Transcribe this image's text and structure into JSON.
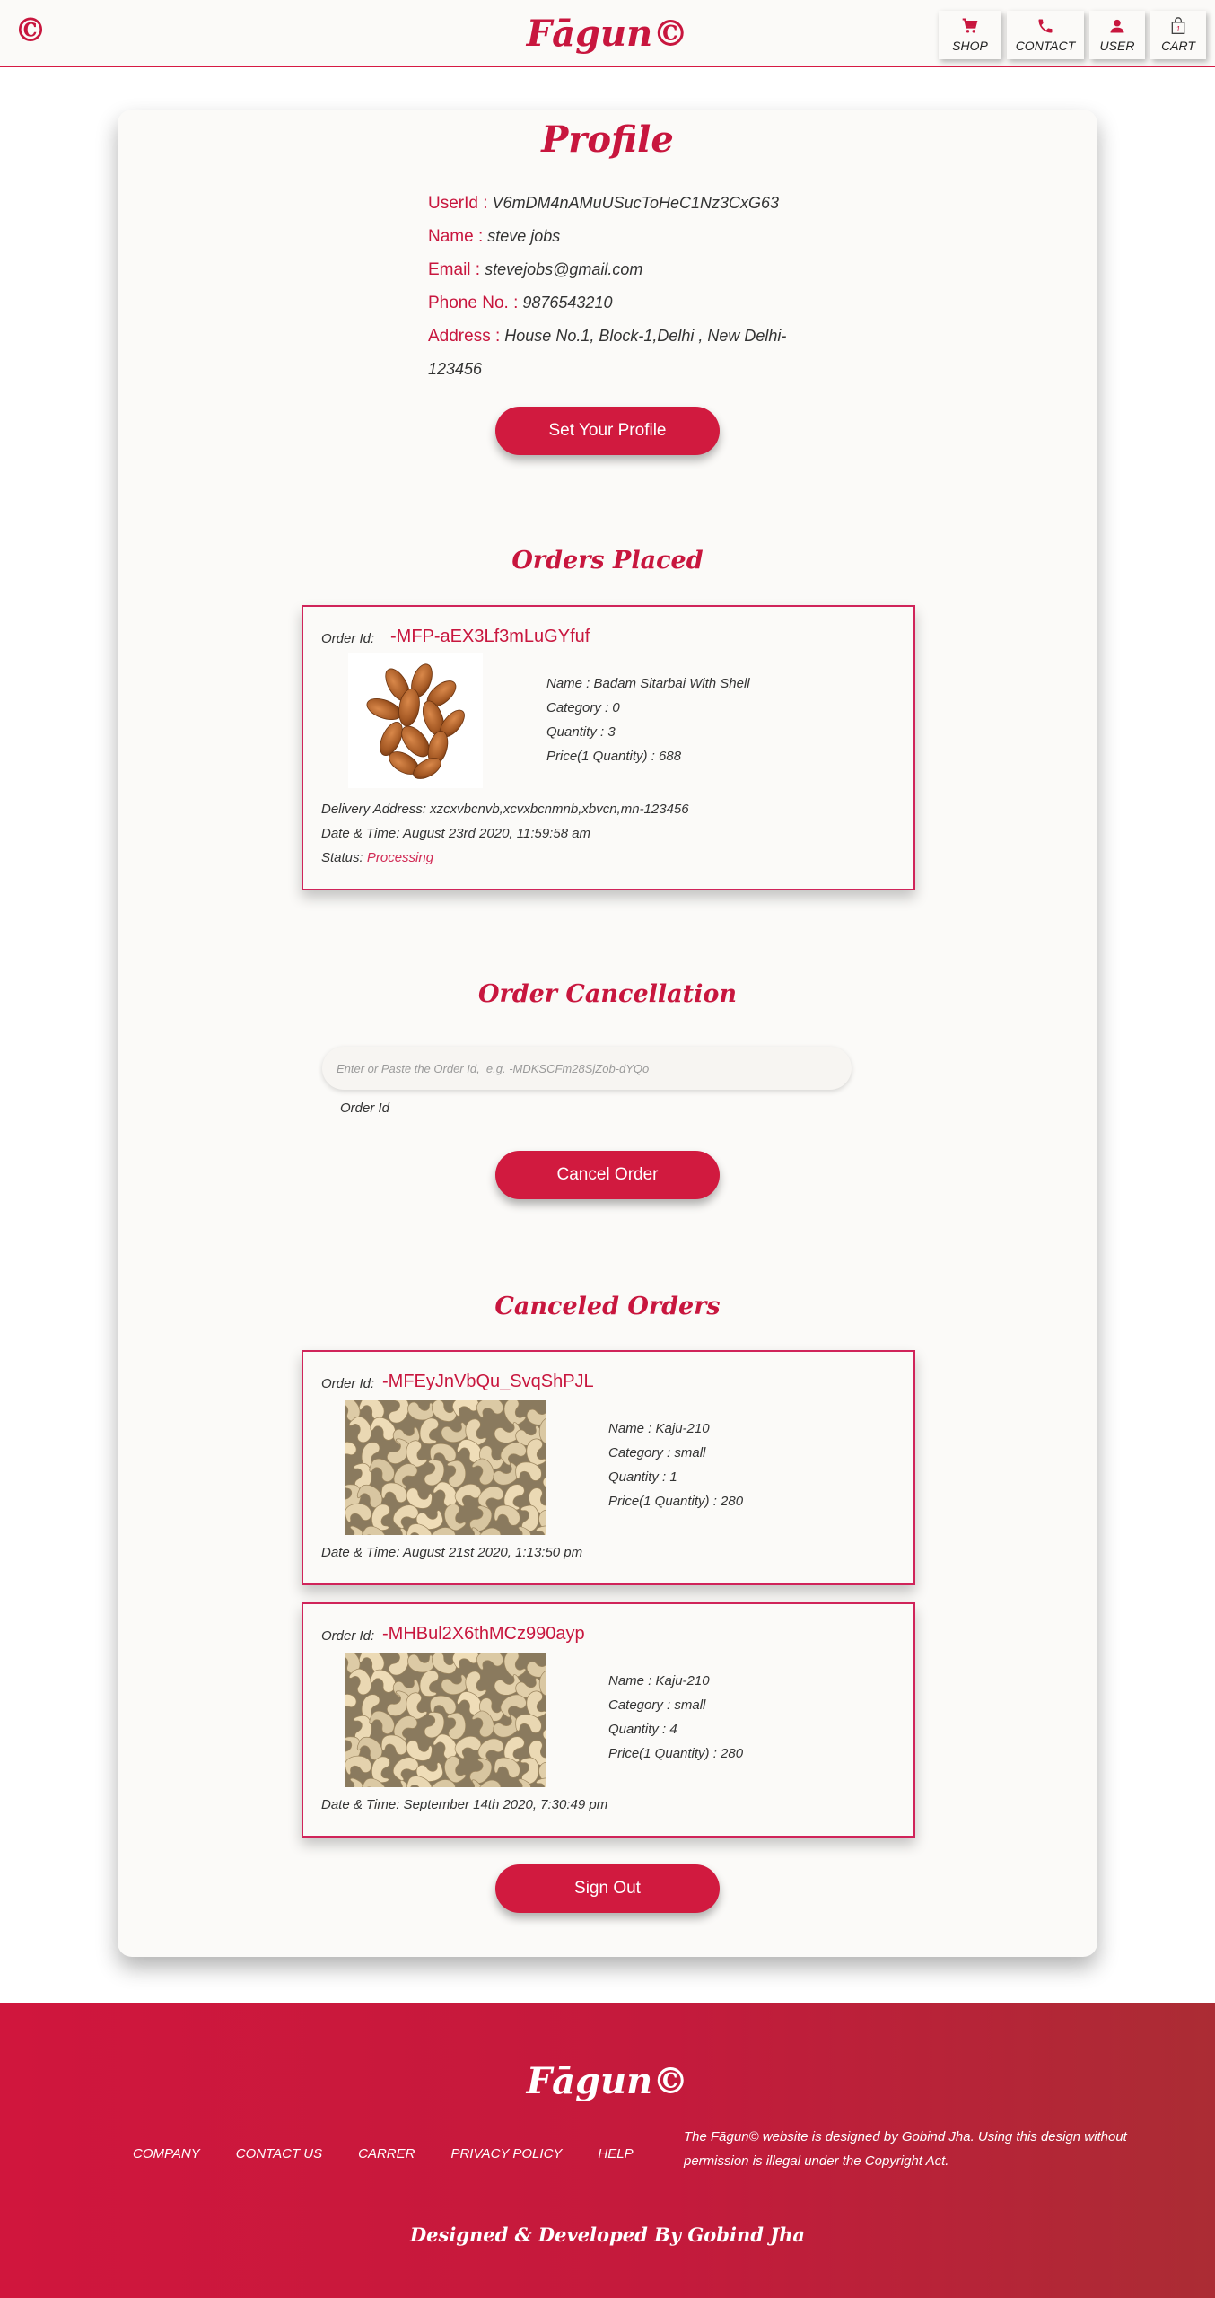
{
  "nav": {
    "logo": "©",
    "brand": "Fāgun©",
    "items": [
      {
        "label": "SHOP",
        "icon": "cart-icon"
      },
      {
        "label": "CONTACT",
        "icon": "phone-icon"
      },
      {
        "label": "USER",
        "icon": "user-icon"
      },
      {
        "label": "CART",
        "icon": "bag-icon",
        "count": "1"
      }
    ]
  },
  "profile": {
    "title": "Profile",
    "fields": [
      {
        "label": "UserId :",
        "value": "V6mDM4nAMuUSucToHeC1Nz3CxG63"
      },
      {
        "label": "Name :",
        "value": "steve jobs"
      },
      {
        "label": "Email :",
        "value": "stevejobs@gmail.com"
      },
      {
        "label": "Phone No. :",
        "value": "9876543210"
      },
      {
        "label": "Address :",
        "value": "House No.1, Block-1,Delhi , New Delhi-123456"
      }
    ],
    "set_profile_button": "Set Your Profile"
  },
  "orders_placed": {
    "title": "Orders Placed",
    "orders": [
      {
        "order_id_label": "Order Id:",
        "order_id": "-MFP-aEX3Lf3mLuGYfuf",
        "image": "almonds",
        "name": "Name : Badam Sitarbai With Shell",
        "category": "Category : 0",
        "quantity": "Quantity : 3",
        "price": "Price(1 Quantity) : 688",
        "delivery": "Delivery Address: xzcxvbcnvb,xcvxbcnmnb,xbvcn,mn-123456",
        "datetime": "Date & Time: August 23rd 2020, 11:59:58 am",
        "status_label": "Status:",
        "status": "Processing"
      }
    ]
  },
  "cancellation": {
    "title": "Order Cancellation",
    "input_placeholder": "Enter or Paste the Order Id,  e.g. -MDKSCFm28SjZob-dYQo",
    "input_label": "Order Id",
    "button": "Cancel Order"
  },
  "canceled_orders": {
    "title": "Canceled Orders",
    "orders": [
      {
        "order_id_label": "Order Id:",
        "order_id": "-MFEyJnVbQu_SvqShPJL",
        "image": "cashews",
        "name": "Name : Kaju-210",
        "category": "Category : small",
        "quantity": "Quantity : 1",
        "price": "Price(1 Quantity) : 280",
        "datetime": "Date & Time: August 21st 2020, 1:13:50 pm"
      },
      {
        "order_id_label": "Order Id:",
        "order_id": "-MHBul2X6thMCz990ayp",
        "image": "cashews",
        "name": "Name : Kaju-210",
        "category": "Category : small",
        "quantity": "Quantity : 4",
        "price": "Price(1 Quantity) : 280",
        "datetime": "Date & Time: September 14th 2020, 7:30:49 pm"
      }
    ]
  },
  "sign_out_button": "Sign Out",
  "footer": {
    "brand": "Fāgun©",
    "links": [
      "COMPANY",
      "CONTACT US",
      "CARRER",
      "PRIVACY POLICY",
      "HELP"
    ],
    "note": "The Fāgun© website is designed by Gobind Jha. Using this design without permission is illegal under the Copyright Act.",
    "credit": "Designed & Developed By Gobind Jha"
  },
  "colors": {
    "accent": "#c8163e",
    "button": "#d11a3f",
    "footer_start": "#d0163d",
    "footer_end": "#ab2c34"
  }
}
